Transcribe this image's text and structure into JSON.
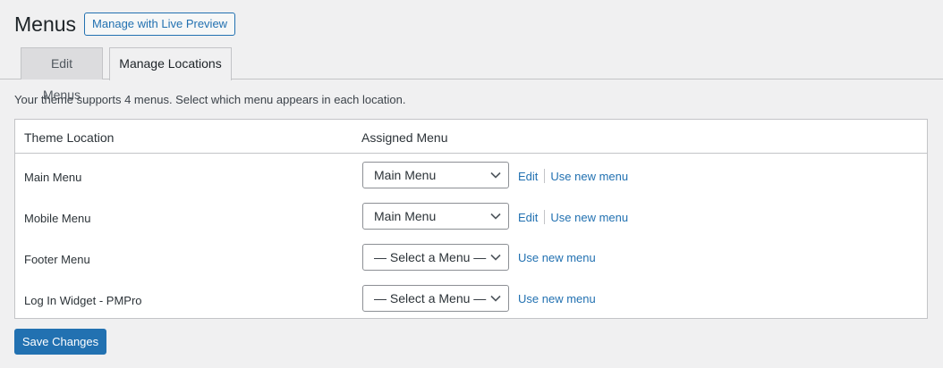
{
  "header": {
    "title": "Menus",
    "live_preview_label": "Manage with Live Preview"
  },
  "tabs": [
    {
      "label": "Edit Menus",
      "active": false
    },
    {
      "label": "Manage Locations",
      "active": true
    }
  ],
  "intro_text": "Your theme supports 4 menus. Select which menu appears in each location.",
  "table": {
    "columns": [
      "Theme Location",
      "Assigned Menu"
    ],
    "rows": [
      {
        "location": "Main Menu",
        "selected": "Main Menu",
        "edit_label": "Edit",
        "new_menu_label": "Use new menu"
      },
      {
        "location": "Mobile Menu",
        "selected": "Main Menu",
        "edit_label": "Edit",
        "new_menu_label": "Use new menu"
      },
      {
        "location": "Footer Menu",
        "selected": "— Select a Menu —",
        "new_menu_label": "Use new menu"
      },
      {
        "location": "Log In Widget - PMPro",
        "selected": "— Select a Menu —",
        "new_menu_label": "Use new menu"
      }
    ]
  },
  "save_label": "Save Changes",
  "colors": {
    "accent": "#2271b1",
    "background": "#f0f0f1",
    "panel": "#ffffff",
    "border": "#c3c4c7"
  }
}
